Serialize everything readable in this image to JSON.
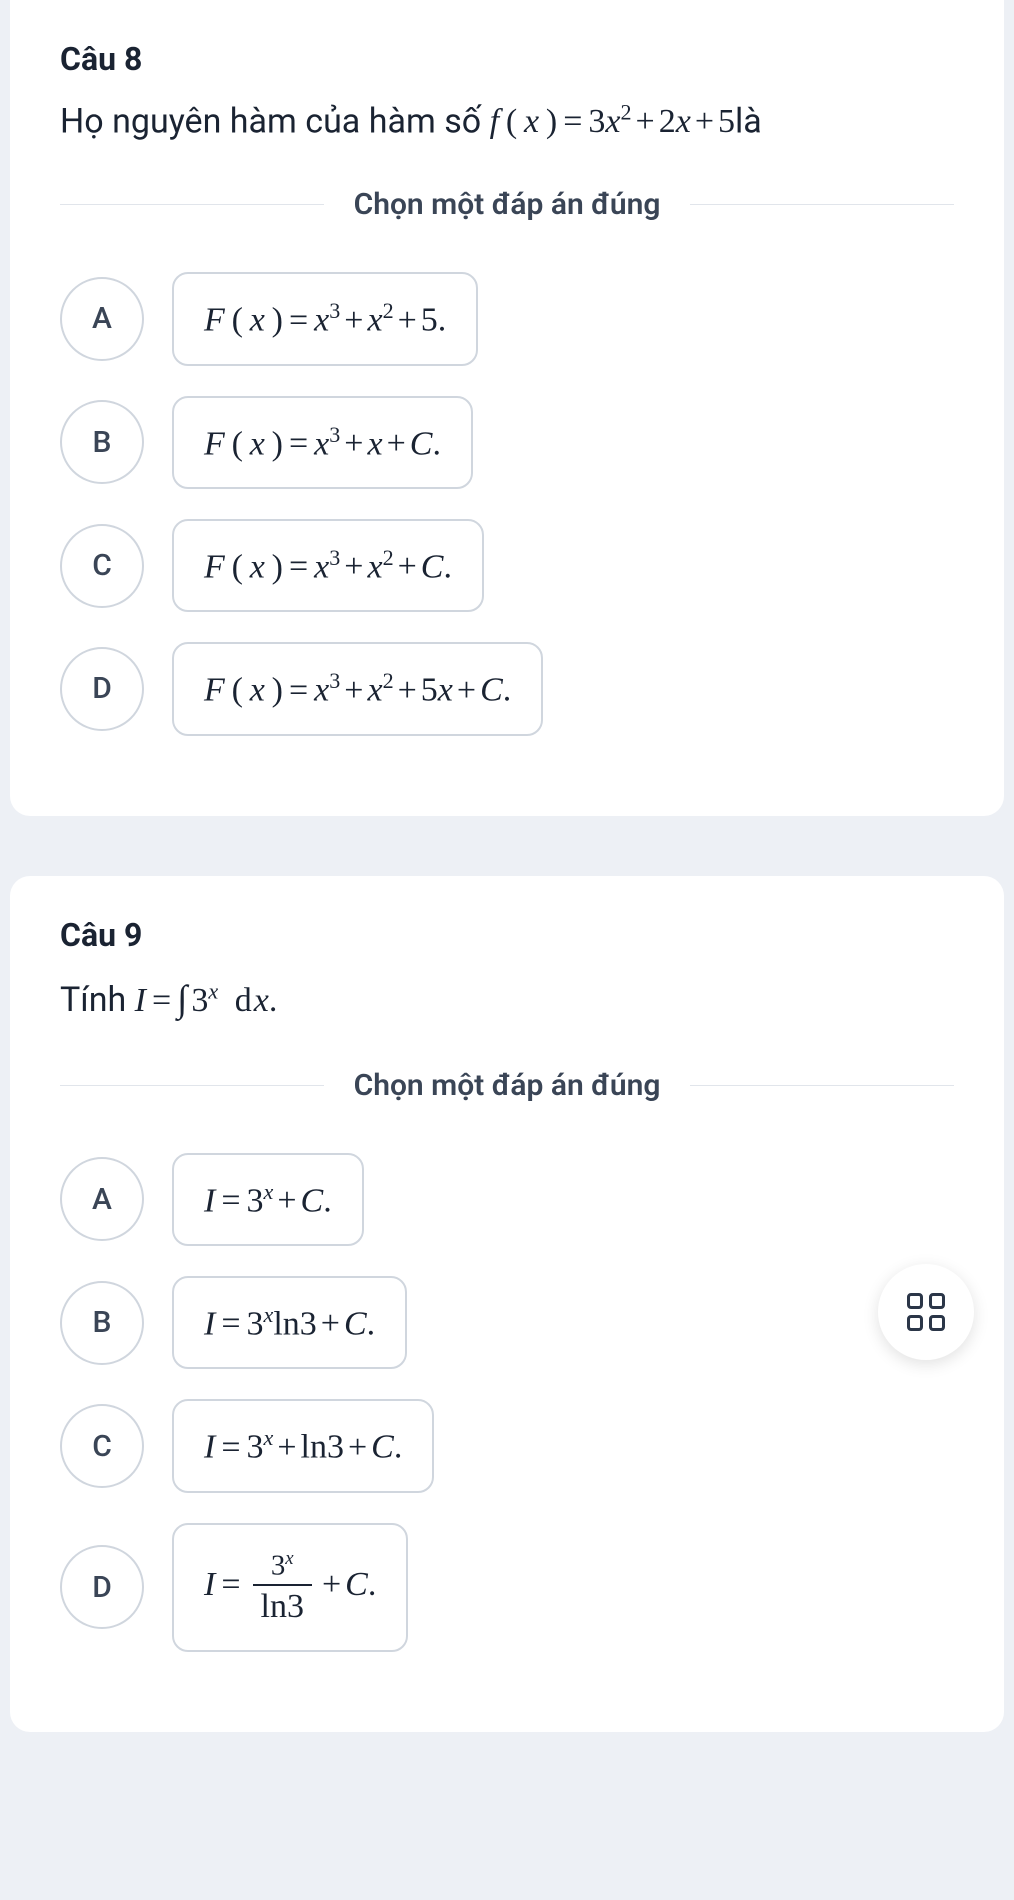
{
  "q8": {
    "title": "Câu 8",
    "prompt_prefix": "Họ nguyên hàm của hàm số ",
    "prompt_math_f": "f",
    "prompt_math_x": "x",
    "prompt_math_rhs_3": "3",
    "prompt_math_rhs_x2": "x",
    "prompt_math_rhs_sup2": "2",
    "prompt_math_rhs_2": "2",
    "prompt_math_rhs_x1": "x",
    "prompt_math_rhs_5": "5",
    "prompt_suffix": "là",
    "instruction": "Chọn một đáp án đúng",
    "optA_letter": "A",
    "optA_F": "F",
    "optA_x": "x",
    "optA_t1_base": "x",
    "optA_t1_exp": "3",
    "optA_t2_base": "x",
    "optA_t2_exp": "2",
    "optA_t3": "5",
    "optA_dot": ".",
    "optB_letter": "B",
    "optB_F": "F",
    "optB_x": "x",
    "optB_t1_base": "x",
    "optB_t1_exp": "3",
    "optB_t2": "x",
    "optB_t3": "C",
    "optB_dot": ".",
    "optC_letter": "C",
    "optC_F": "F",
    "optC_x": "x",
    "optC_t1_base": "x",
    "optC_t1_exp": "3",
    "optC_t2_base": "x",
    "optC_t2_exp": "2",
    "optC_t3": "C",
    "optC_dot": ".",
    "optD_letter": "D",
    "optD_F": "F",
    "optD_x": "x",
    "optD_t1_base": "x",
    "optD_t1_exp": "3",
    "optD_t2_base": "x",
    "optD_t2_exp": "2",
    "optD_t3_coef": "5",
    "optD_t3_x": "x",
    "optD_t4": "C",
    "optD_dot": "."
  },
  "q9": {
    "title": "Câu 9",
    "prompt_prefix": "Tính ",
    "prompt_I": "I",
    "prompt_int": "∫",
    "prompt_base": "3",
    "prompt_exp": "x",
    "prompt_d": "d",
    "prompt_dx_x": "x",
    "prompt_dot": ".",
    "instruction": "Chọn một đáp án đúng",
    "optA_letter": "A",
    "optA_I": "I",
    "optA_base": "3",
    "optA_exp": "x",
    "optA_C": "C",
    "optA_dot": ".",
    "optB_letter": "B",
    "optB_I": "I",
    "optB_base": "3",
    "optB_exp": "x",
    "optB_ln": "ln",
    "optB_ln3": "3",
    "optB_C": "C",
    "optB_dot": ".",
    "optC_letter": "C",
    "optC_I": "I",
    "optC_base": "3",
    "optC_exp": "x",
    "optC_ln": "ln",
    "optC_ln3": "3",
    "optC_C": "C",
    "optC_dot": ".",
    "optD_letter": "D",
    "optD_I": "I",
    "optD_top_base": "3",
    "optD_top_exp": "x",
    "optD_bot_ln": "ln",
    "optD_bot_3": "3",
    "optD_C": "C",
    "optD_dot": "."
  }
}
